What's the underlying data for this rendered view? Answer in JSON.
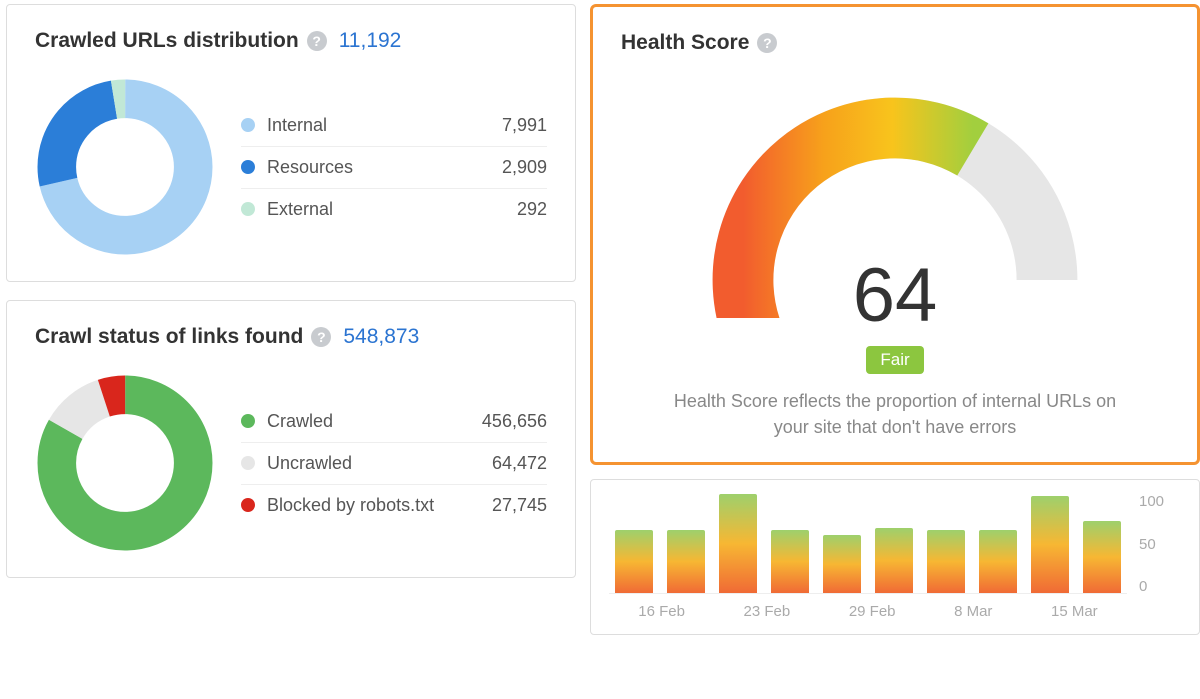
{
  "panels": {
    "crawled_urls": {
      "title": "Crawled URLs distribution",
      "total": "11,192",
      "items": [
        {
          "label": "Internal",
          "value": "7,991",
          "value_n": 7991,
          "color": "#a7d1f4"
        },
        {
          "label": "Resources",
          "value": "2,909",
          "value_n": 2909,
          "color": "#2b7ed8"
        },
        {
          "label": "External",
          "value": "292",
          "value_n": 292,
          "color": "#c1e8d6"
        }
      ]
    },
    "crawl_status": {
      "title": "Crawl status of links found",
      "total": "548,873",
      "items": [
        {
          "label": "Crawled",
          "value": "456,656",
          "value_n": 456656,
          "color": "#5cb85c"
        },
        {
          "label": "Uncrawled",
          "value": "64,472",
          "value_n": 64472,
          "color": "#e6e6e6"
        },
        {
          "label": "Blocked by robots.txt",
          "value": "27,745",
          "value_n": 27745,
          "color": "#d9261c"
        }
      ]
    },
    "health": {
      "title": "Health Score",
      "score": "64",
      "score_n": 64,
      "badge": "Fair",
      "description": "Health Score reflects the proportion of internal URLs on your site that don't have errors"
    },
    "history_chart": {
      "y_ticks": [
        "100",
        "50",
        "0"
      ],
      "x_ticks": [
        "16 Feb",
        "23 Feb",
        "29 Feb",
        "8 Mar",
        "15 Mar"
      ],
      "bars": [
        70,
        70,
        110,
        70,
        65,
        73,
        70,
        70,
        108,
        80
      ]
    }
  },
  "chart_data": [
    {
      "type": "pie",
      "title": "Crawled URLs distribution",
      "categories": [
        "Internal",
        "Resources",
        "External"
      ],
      "values": [
        7991,
        2909,
        292
      ],
      "total": 11192,
      "colors": [
        "#a7d1f4",
        "#2b7ed8",
        "#c1e8d6"
      ]
    },
    {
      "type": "pie",
      "title": "Crawl status of links found",
      "categories": [
        "Crawled",
        "Uncrawled",
        "Blocked by robots.txt"
      ],
      "values": [
        456656,
        64472,
        27745
      ],
      "total": 548873,
      "colors": [
        "#5cb85c",
        "#e6e6e6",
        "#d9261c"
      ]
    },
    {
      "type": "bar",
      "title": "Health Score history",
      "categories": [
        "",
        "",
        "16 Feb",
        "",
        "23 Feb",
        "",
        "29 Feb",
        "",
        "8 Mar",
        "15 Mar"
      ],
      "values": [
        70,
        70,
        110,
        70,
        65,
        73,
        70,
        70,
        108,
        80
      ],
      "ylabel": "",
      "ylim": [
        0,
        110
      ]
    }
  ]
}
